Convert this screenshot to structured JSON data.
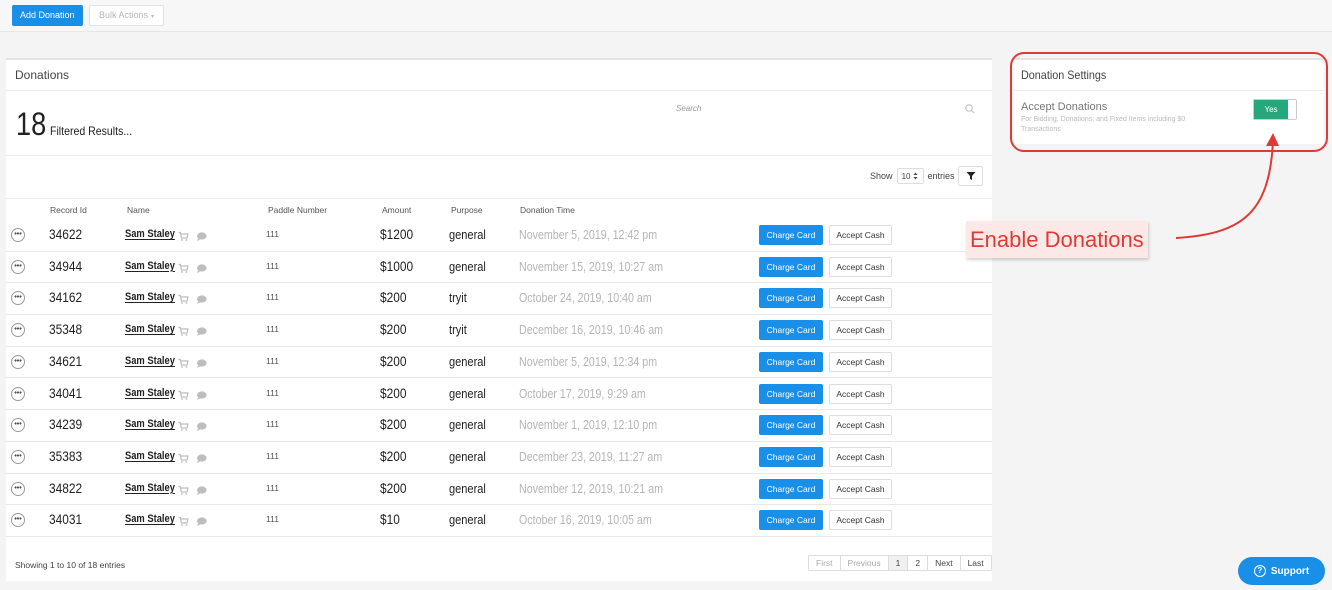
{
  "toolbar": {
    "add_label": "Add Donation",
    "bulk_label": "Bulk Actions",
    "bulk_caret": "▾"
  },
  "donations": {
    "title": "Donations",
    "count": "18",
    "count_label": "Filtered Results...",
    "search_placeholder": "Search",
    "show_label": "Show",
    "entries_value": "10",
    "entries_label": "entries",
    "columns": [
      "Record Id",
      "Name",
      "Paddle Number",
      "Amount",
      "Purpose",
      "Donation Time"
    ],
    "charge_label": "Charge Card",
    "cash_label": "Accept Cash",
    "rows": [
      {
        "id": "34622",
        "name": "Sam Staley",
        "paddle": "111",
        "amount": "$1200",
        "purpose": "general",
        "time": "November 5, 2019, 12:42 pm"
      },
      {
        "id": "34944",
        "name": "Sam Staley",
        "paddle": "111",
        "amount": "$1000",
        "purpose": "general",
        "time": "November 15, 2019, 10:27 am"
      },
      {
        "id": "34162",
        "name": "Sam Staley",
        "paddle": "111",
        "amount": "$200",
        "purpose": "tryit",
        "time": "October 24, 2019, 10:40 am"
      },
      {
        "id": "35348",
        "name": "Sam Staley",
        "paddle": "111",
        "amount": "$200",
        "purpose": "tryit",
        "time": "December 16, 2019, 10:46 am"
      },
      {
        "id": "34621",
        "name": "Sam Staley",
        "paddle": "111",
        "amount": "$200",
        "purpose": "general",
        "time": "November 5, 2019, 12:34 pm"
      },
      {
        "id": "34041",
        "name": "Sam Staley",
        "paddle": "111",
        "amount": "$200",
        "purpose": "general",
        "time": "October 17, 2019, 9:29 am"
      },
      {
        "id": "34239",
        "name": "Sam Staley",
        "paddle": "111",
        "amount": "$200",
        "purpose": "general",
        "time": "November 1, 2019, 12:10 pm"
      },
      {
        "id": "35383",
        "name": "Sam Staley",
        "paddle": "111",
        "amount": "$200",
        "purpose": "general",
        "time": "December 23, 2019, 11:27 am"
      },
      {
        "id": "34822",
        "name": "Sam Staley",
        "paddle": "111",
        "amount": "$200",
        "purpose": "general",
        "time": "November 12, 2019, 10:21 am"
      },
      {
        "id": "34031",
        "name": "Sam Staley",
        "paddle": "111",
        "amount": "$10",
        "purpose": "general",
        "time": "October 16, 2019, 10:05 am"
      }
    ],
    "showing": "Showing 1 to 10 of 18 entries",
    "pager": [
      "First",
      "Previous",
      "1",
      "2",
      "Next",
      "Last"
    ],
    "active_page": "1"
  },
  "settings": {
    "title": "Donation Settings",
    "accept_label": "Accept Donations",
    "accept_desc": "For Bidding, Donations, and Fixed Items including $0 Transactions",
    "toggle_label": "Yes"
  },
  "annotation": {
    "label": "Enable Donations"
  },
  "support": {
    "label": "Support"
  },
  "colors": {
    "primary": "#1a8fe8",
    "toggle_on": "#26a87c",
    "annotation": "#e03a34"
  }
}
